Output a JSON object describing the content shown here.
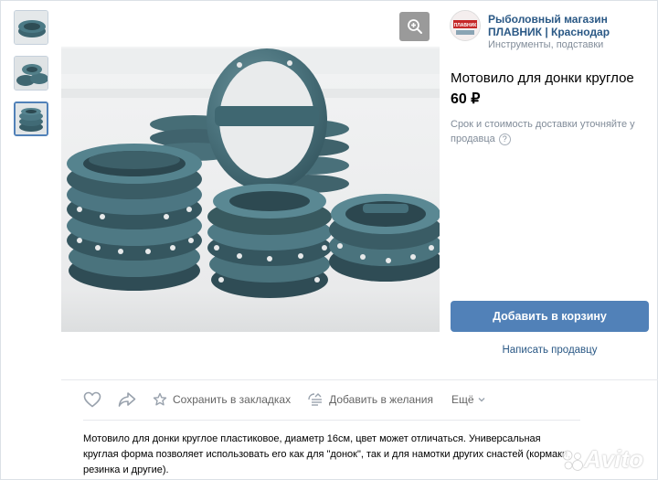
{
  "seller": {
    "name": "Рыболовный магазин ПЛАВНИК | Краснодар",
    "category": "Инструменты, подставки",
    "avatar_text": "ПЛАВНИК"
  },
  "product": {
    "title": "Мотовило для донки круглое",
    "price": "60 ₽",
    "delivery_note": "Срок и стоимость доставки уточняйте у продавца",
    "help_glyph": "?"
  },
  "buttons": {
    "add_to_cart": "Добавить в корзину",
    "write_seller": "Написать продавцу"
  },
  "actions": {
    "save_bookmarks": "Сохранить в закладках",
    "add_wishlist": "Добавить в желания",
    "more": "Ещё"
  },
  "description": "Мотовило для донки круглое пластиковое, диаметр 16см, цвет может отличаться. Универсальная круглая форма позволяет использовать его как для \"донок\", так и для намотки других снастей (кормаки, резинка и другие).",
  "watermark": "Avito",
  "colors": {
    "accent": "#5181b8",
    "link": "#2a5885",
    "secondary_text": "#818c99"
  },
  "thumbnails": [
    {
      "name": "thumb-1",
      "active": false
    },
    {
      "name": "thumb-2",
      "active": false
    },
    {
      "name": "thumb-3",
      "active": true
    }
  ]
}
